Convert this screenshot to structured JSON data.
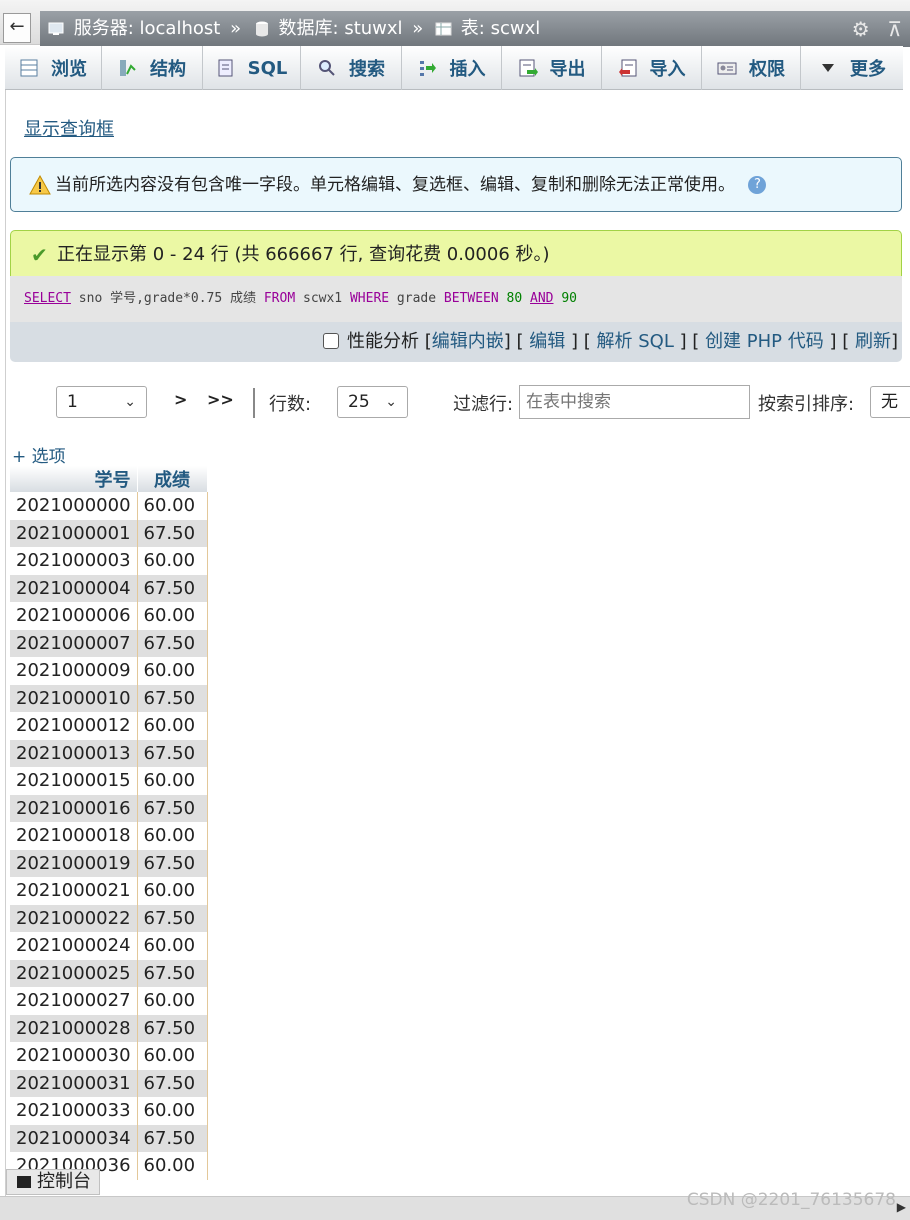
{
  "breadcrumb": {
    "server": "服务器: localhost",
    "database": "数据库: stuwxl",
    "table": "表: scwxl",
    "separator": "»"
  },
  "tabs": [
    {
      "label": "浏览",
      "icon": "browse-icon"
    },
    {
      "label": "结构",
      "icon": "structure-icon"
    },
    {
      "label": "SQL",
      "icon": "sql-icon"
    },
    {
      "label": "搜索",
      "icon": "search-icon"
    },
    {
      "label": "插入",
      "icon": "insert-icon"
    },
    {
      "label": "导出",
      "icon": "export-icon"
    },
    {
      "label": "导入",
      "icon": "import-icon"
    },
    {
      "label": "权限",
      "icon": "privileges-icon"
    },
    {
      "label": "更多",
      "icon": "more-icon"
    }
  ],
  "show_query_link": "显示查询框",
  "notice_text": "当前所选内容没有包含唯一字段。单元格编辑、复选框、编辑、复制和删除无法正常使用。",
  "success_text": "正在显示第 0 - 24 行 (共 666667 行, 查询花费 0.0006 秒。)",
  "sql": {
    "select": "SELECT",
    "part1": " sno 学号,grade*0.75 成绩 ",
    "from": "FROM",
    "part2": " scwx1 ",
    "where": "WHERE",
    "part3": " grade ",
    "between": "BETWEEN",
    "v1": "80",
    "and": "AND",
    "v2": "90"
  },
  "sql_actions": {
    "profiling": "性能分析",
    "inline_edit": "编辑内嵌",
    "edit": "编辑",
    "explain": "解析 SQL",
    "php": "创建 PHP 代码",
    "refresh": "刷新"
  },
  "nav": {
    "page_value": "1",
    "next": ">",
    "last": ">>",
    "rows_label": "行数:",
    "rows_value": "25",
    "filter_label": "过滤行:",
    "filter_placeholder": "在表中搜索",
    "sort_label": "按索引排序:",
    "sort_value": "无"
  },
  "options_link": "+ 选项",
  "columns": [
    "学号",
    "成绩"
  ],
  "rows": [
    [
      "2021000000",
      "60.00"
    ],
    [
      "2021000001",
      "67.50"
    ],
    [
      "2021000003",
      "60.00"
    ],
    [
      "2021000004",
      "67.50"
    ],
    [
      "2021000006",
      "60.00"
    ],
    [
      "2021000007",
      "67.50"
    ],
    [
      "2021000009",
      "60.00"
    ],
    [
      "2021000010",
      "67.50"
    ],
    [
      "2021000012",
      "60.00"
    ],
    [
      "2021000013",
      "67.50"
    ],
    [
      "2021000015",
      "60.00"
    ],
    [
      "2021000016",
      "67.50"
    ],
    [
      "2021000018",
      "60.00"
    ],
    [
      "2021000019",
      "67.50"
    ],
    [
      "2021000021",
      "60.00"
    ],
    [
      "2021000022",
      "67.50"
    ],
    [
      "2021000024",
      "60.00"
    ],
    [
      "2021000025",
      "67.50"
    ],
    [
      "2021000027",
      "60.00"
    ],
    [
      "2021000028",
      "67.50"
    ],
    [
      "2021000030",
      "60.00"
    ],
    [
      "2021000031",
      "67.50"
    ],
    [
      "2021000033",
      "60.00"
    ],
    [
      "2021000034",
      "67.50"
    ],
    [
      "2021000036",
      "60.00"
    ]
  ],
  "console_label": "控制台",
  "watermark": "CSDN @2201_76135678"
}
